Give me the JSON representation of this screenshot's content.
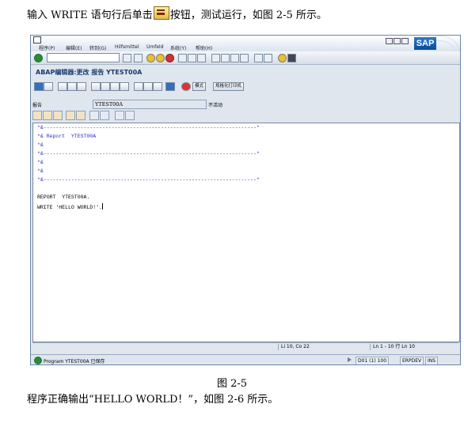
{
  "doc": {
    "intro_before": "输入 WRITE 语句行后单击",
    "intro_after": "按钮，测试运行，如图 2-5 所示。",
    "caption": "图 2-5",
    "outro": "程序正确输出“HELLO WORLD！”，如图 2-6 所示。"
  },
  "menubar": {
    "items": [
      "程序(P)",
      "编辑(E)",
      "转到(G)",
      "Hilfsmittel",
      "Umfeld",
      "系统(Y)",
      "帮助(H)"
    ],
    "logo": "SAP"
  },
  "title": "ABAP编辑器:更改 报告 YTEST00A",
  "appbar": {
    "mode_button": "模式",
    "pretty_printer_button": "规格化打印机"
  },
  "field": {
    "label": "报告",
    "value": "YTEST00A",
    "status": "不活动"
  },
  "editor": {
    "comment_lines": [
      "*&---------------------------------------------------------------------*",
      "*& Report  YTEST00A",
      "*&",
      "*&---------------------------------------------------------------------*",
      "*&",
      "*&",
      "*&---------------------------------------------------------------------*"
    ],
    "code_lines": [
      "REPORT  YTEST00A.",
      "WRITE 'HELLO WORLD!'."
    ]
  },
  "position": {
    "cursor": "Li 10, Co 22",
    "range": "Ln 1 - 10 行 Ln 10"
  },
  "statusbar": {
    "message": "Program YTEST00A 已保存",
    "system": "D01 (1) 100",
    "server": "ERPDEV",
    "mode": "INS"
  },
  "icons": [
    "ok-icon",
    "save-icon",
    "back-icon",
    "exit-icon",
    "cancel-icon",
    "print-icon",
    "find-icon",
    "test-icon",
    "help-icon"
  ],
  "colors": {
    "comment": "#2a2ad0",
    "title": "#1a3c6e",
    "window_bg": "#dfe6ee"
  }
}
